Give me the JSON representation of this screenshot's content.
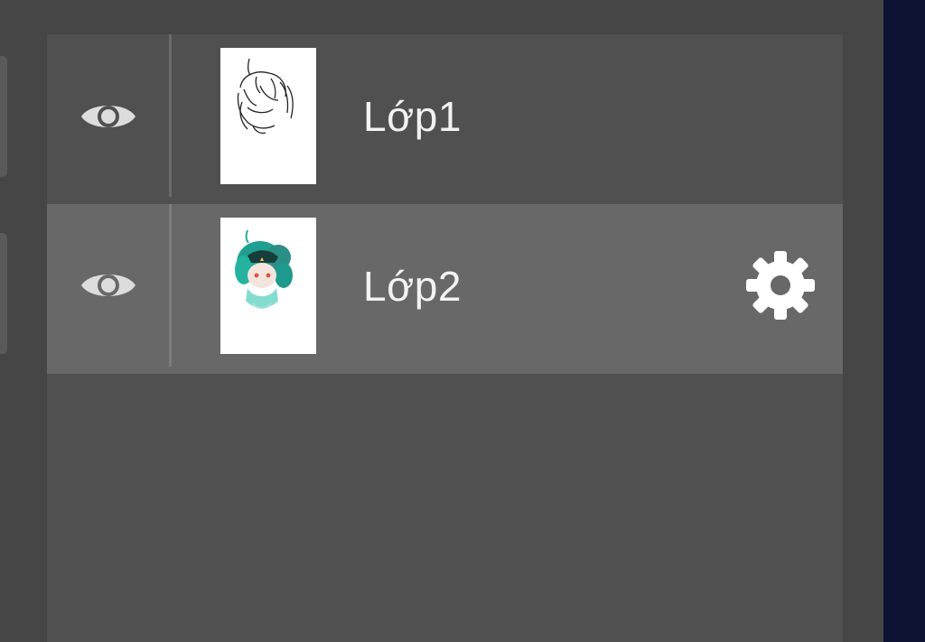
{
  "layers": [
    {
      "name": "Lớp1",
      "visible": true,
      "selected": false,
      "thumbnail_icon": "line-sketch-thumbnail"
    },
    {
      "name": "Lớp2",
      "visible": true,
      "selected": true,
      "thumbnail_icon": "colored-character-thumbnail"
    }
  ],
  "icons": {
    "visibility": "eye-icon",
    "settings": "gear-icon"
  },
  "colors": {
    "background": "#464646",
    "panel": "#505050",
    "selected_row": "#686868",
    "text": "#f2f2f2",
    "accent_strip": "#0e1232"
  }
}
